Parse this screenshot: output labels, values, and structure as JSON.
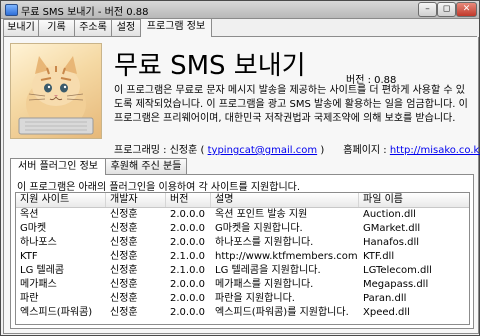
{
  "window": {
    "title": "무료 SMS 보내기 - 버전 0.88"
  },
  "tabs": [
    "보내기",
    "기록",
    "주소록",
    "설정",
    "프로그램 정보"
  ],
  "about": {
    "app_title": "무료 SMS 보내기",
    "version": "버전 : 0.88",
    "description": "이 프로그램은 무료로 문자 메시지 발송을 제공하는 사이트를 더 편하게 사용할 수 있도록 제작되었습니다. 이 프로그램을 광고 SMS 발송에 활용하는 일을 엄금합니다. 이 프로그램은 프리웨어이며, 대한민국 저작권법과 국제조약에 의해 보호를 받습니다.",
    "programmer_label": "프로그래밍 : 신정훈 (",
    "email": "typingcat@gmail.com",
    "programmer_suffix": ")",
    "homepage_label": "홈페이지 :",
    "homepage_url": "http://misako.co.kr"
  },
  "subtabs": [
    "서버 플러그인 정보",
    "후원해 주신 분들"
  ],
  "plugins": {
    "intro": "이 프로그램은 아래의 플러그인을 이용하여 각 사이트를 지원합니다.",
    "columns": [
      "지원 사이트",
      "개발자",
      "버전",
      "설명",
      "파일 이름"
    ],
    "rows": [
      [
        "옥션",
        "신정훈",
        "2.0.0.0",
        "옥션 포인트 발송 지원",
        "Auction.dll"
      ],
      [
        "G마켓",
        "신정훈",
        "2.0.0.0",
        "G마켓을 지원합니다.",
        "GMarket.dll"
      ],
      [
        "하나포스",
        "신정훈",
        "2.0.0.0",
        "하나포스를 지원합니다.",
        "Hanafos.dll"
      ],
      [
        "KTF",
        "신정훈",
        "2.1.0.0",
        "http://www.ktfmembers.com ...",
        "KTF.dll"
      ],
      [
        "LG 텔레콤",
        "신정훈",
        "2.1.0.0",
        "LG 텔레콤을 지원합니다.",
        "LGTelecom.dll"
      ],
      [
        "메가패스",
        "신정훈",
        "2.0.0.0",
        "메가패스를 지원합니다.",
        "Megapass.dll"
      ],
      [
        "파란",
        "신정훈",
        "2.0.0.0",
        "파란을 지원합니다.",
        "Paran.dll"
      ],
      [
        "엑스피드(파워콤)",
        "신정훈",
        "2.0.0.0",
        "엑스피드(파워콤)를 지원합니다.",
        "Xpeed.dll"
      ]
    ]
  },
  "icons": {
    "app": "sms-app-icon",
    "logo": "kitten-logo",
    "minimize": "minimize-icon",
    "maximize": "maximize-icon",
    "close": "close-icon"
  }
}
